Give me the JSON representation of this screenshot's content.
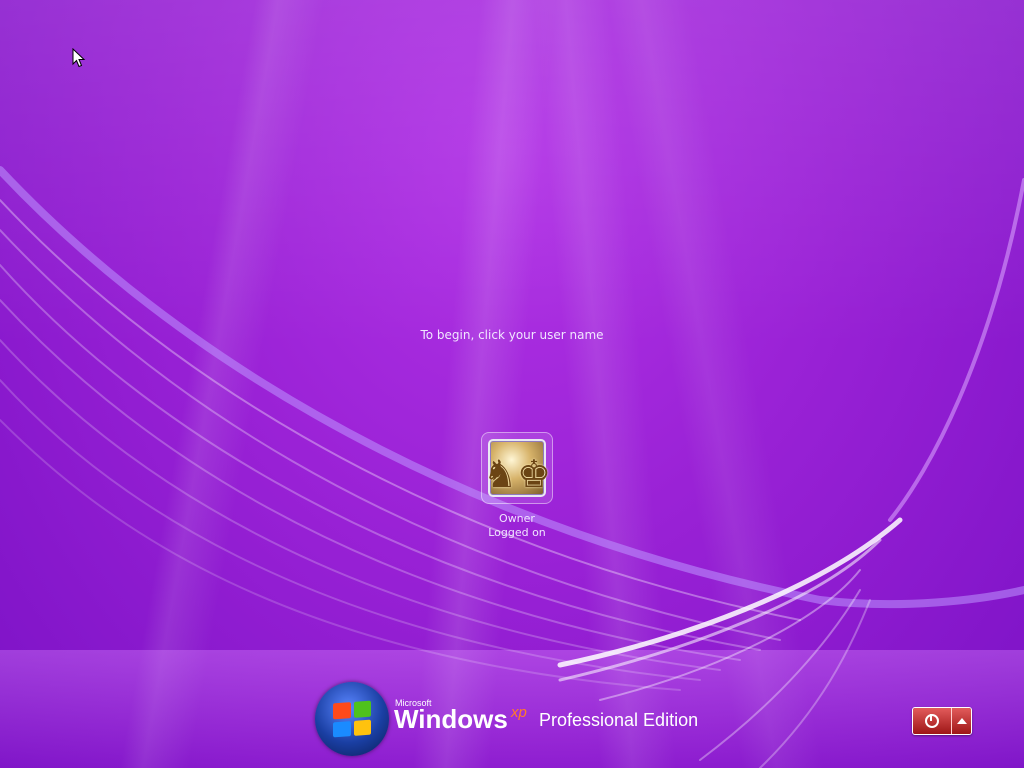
{
  "login": {
    "prompt": "To begin, click your user name"
  },
  "user": {
    "name": "Owner",
    "status": "Logged on",
    "avatar_icon": "chess-pieces-icon"
  },
  "branding": {
    "microsoft": "Microsoft",
    "windows": "Windows",
    "xp": "xp",
    "edition": "Professional Edition"
  },
  "power": {
    "icon": "power-icon",
    "arrow_icon": "arrow-up-icon"
  },
  "colors": {
    "background": "#9a22d6",
    "power_button": "#c03030",
    "xp_accent": "#ff7a2a",
    "text": "#f1e6ff"
  }
}
